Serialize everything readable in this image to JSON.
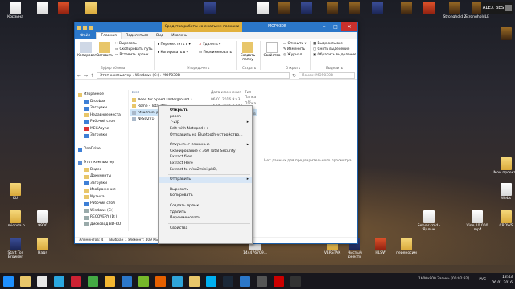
{
  "desktop": {
    "user_name": "ALEX BES",
    "icons": [
      {
        "label": "Корзина",
        "type": "file"
      },
      {
        "label": "",
        "type": "file"
      },
      {
        "label": "",
        "type": "red"
      },
      {
        "label": "",
        "type": "folder"
      },
      {
        "label": "",
        "type": "app"
      },
      {
        "label": "",
        "type": "file"
      },
      {
        "label": "",
        "type": "game"
      },
      {
        "label": "",
        "type": "app"
      },
      {
        "label": "",
        "type": "game"
      },
      {
        "label": "",
        "type": "game"
      },
      {
        "label": "",
        "type": "app"
      },
      {
        "label": "",
        "type": "game"
      },
      {
        "label": "",
        "type": "red"
      },
      {
        "label": "Stronghold 2",
        "type": "game"
      },
      {
        "label": "StrongholdLE",
        "type": "game"
      },
      {
        "label": "",
        "type": "game"
      },
      {
        "label": "KU",
        "type": "folder"
      },
      {
        "label": "Lmionda.b",
        "type": "folder"
      },
      {
        "label": "9900",
        "type": "file"
      },
      {
        "label": "Start Tor Browser",
        "type": "app"
      },
      {
        "label": "Надя",
        "type": "folder"
      },
      {
        "label": "144476709...",
        "type": "file"
      },
      {
        "label": "VERSTAK",
        "type": "folder"
      },
      {
        "label": "Чистый реестр",
        "type": "app"
      },
      {
        "label": "HLSW",
        "type": "red"
      },
      {
        "label": "переносим",
        "type": "folder"
      },
      {
        "label": "Server.cmd - Ярлык",
        "type": "file"
      },
      {
        "label": "Vine 10.000 .mp4",
        "type": "file"
      },
      {
        "label": "CROWS",
        "type": "folder"
      },
      {
        "label": "Мои проекты",
        "type": "folder"
      },
      {
        "label": "Webs",
        "type": "file"
      }
    ]
  },
  "explorer": {
    "title": "МОР030В",
    "context_tab": "Средства работы со сжатыми папками",
    "tabs": [
      "Файл",
      "Главная",
      "Поделиться",
      "Вид",
      "Извлечь"
    ],
    "active_tab": "Главная",
    "ribbon": {
      "copy": "Копировать",
      "paste": "Вставить",
      "cut": "Вырезать",
      "copy_path": "Скопировать путь",
      "paste_shortcut": "Вставить ярлык",
      "group_clipboard": "Буфер обмена",
      "move_to": "Переместить в",
      "copy_to": "Копировать в",
      "delete": "Удалить",
      "rename": "Переименовать",
      "group_organize": "Упорядочить",
      "new_folder": "Создать папку",
      "group_create": "Создать",
      "properties": "Свойства",
      "group_open": "Открыть",
      "open": "Открыть",
      "edit": "Изменить",
      "history": "Журнал",
      "select_all": "Выделить все",
      "select_none": "Снять выделение",
      "invert": "Обратить выделение",
      "group_select": "Выделить"
    },
    "address": "Этот компьютер › Windows (C:) › МОР030В",
    "search_placeholder": "Поиск: МОР030В",
    "nav": [
      {
        "label": "Избранное",
        "sub": false,
        "color": "#e8c66a"
      },
      {
        "label": "Dropbox",
        "sub": true,
        "color": "#3d7fd6"
      },
      {
        "label": "Загрузки",
        "sub": true,
        "color": "#3d7fd6"
      },
      {
        "label": "Недавние места",
        "sub": true,
        "color": "#e8c66a"
      },
      {
        "label": "Рабочий стол",
        "sub": true,
        "color": "#3d7fd6"
      },
      {
        "label": "MEGAsync",
        "sub": true,
        "color": "#d33"
      },
      {
        "label": "Загрузки",
        "sub": true,
        "color": "#3d7fd6"
      },
      {
        "label": "",
        "sub": false,
        "color": "#fff"
      },
      {
        "label": "OneDrive",
        "sub": false,
        "color": "#3d7fd6"
      },
      {
        "label": "",
        "sub": false,
        "color": "#fff"
      },
      {
        "label": "Этот компьютер",
        "sub": false,
        "color": "#5a8dd6"
      },
      {
        "label": "Видео",
        "sub": true,
        "color": "#e8c66a"
      },
      {
        "label": "Документы",
        "sub": true,
        "color": "#e8c66a"
      },
      {
        "label": "Загрузки",
        "sub": true,
        "color": "#3d7fd6"
      },
      {
        "label": "Изображения",
        "sub": true,
        "color": "#e8c66a"
      },
      {
        "label": "Музыка",
        "sub": true,
        "color": "#e8c66a"
      },
      {
        "label": "Рабочий стол",
        "sub": true,
        "color": "#3d7fd6"
      },
      {
        "label": "Windows (C:)",
        "sub": true,
        "color": "#9aa"
      },
      {
        "label": "RECOVERY (D:)",
        "sub": true,
        "color": "#9aa"
      },
      {
        "label": "Дисковод BD-RO",
        "sub": true,
        "color": "#9aa"
      }
    ],
    "columns": [
      "Имя",
      "Дата изменения",
      "Тип"
    ],
    "files": [
      {
        "name": "Need for Speed Underground 2",
        "date": "06.01.2016 9:43",
        "type": "Папка с ф",
        "selected": false,
        "color": "#e8c66a"
      },
      {
        "name": "Rome - Total War",
        "date": "16.06.2015 22:44",
        "type": "Папка с ф",
        "selected": false,
        "color": "#e8c66a"
      },
      {
        "name": "nfsu2mini-pk8.zip",
        "date": "06.01.2016 13:38",
        "type": "zip-Архив",
        "selected": true,
        "color": "#a9b8c9"
      },
      {
        "name": "NFSU2V1-",
        "date": "",
        "type": "",
        "selected": false,
        "color": "#a9b8c9"
      }
    ],
    "preview_text": "Нет данных для предварительного просмотра.",
    "status": {
      "items": "Элементов: 4",
      "selected": "Выбран 1 элемент: 409 КБ"
    }
  },
  "context_menu": [
    {
      "label": "Открыть",
      "bold": true,
      "arrow": false,
      "sep_before": false,
      "hl": false
    },
    {
      "label": "poosh",
      "bold": false,
      "arrow": false,
      "sep_before": false,
      "hl": false
    },
    {
      "label": "7-Zip",
      "bold": false,
      "arrow": true,
      "sep_before": false,
      "hl": false
    },
    {
      "label": "Edit with Notepad++",
      "bold": false,
      "arrow": false,
      "sep_before": false,
      "hl": false
    },
    {
      "label": "Отправить на Bluetooth-устройство...",
      "bold": false,
      "arrow": false,
      "sep_before": false,
      "hl": false
    },
    {
      "label": "Открыть с помощью",
      "bold": false,
      "arrow": true,
      "sep_before": true,
      "hl": false
    },
    {
      "label": "Сканирование с 360 Total Security",
      "bold": false,
      "arrow": false,
      "sep_before": false,
      "hl": false
    },
    {
      "label": "Extract files...",
      "bold": false,
      "arrow": false,
      "sep_before": false,
      "hl": false
    },
    {
      "label": "Extract Here",
      "bold": false,
      "arrow": false,
      "sep_before": false,
      "hl": false
    },
    {
      "label": "Extract to nfsu2mini-pk8\\",
      "bold": false,
      "arrow": false,
      "sep_before": false,
      "hl": false
    },
    {
      "label": "Отправить",
      "bold": false,
      "arrow": true,
      "sep_before": true,
      "hl": true
    },
    {
      "label": "Вырезать",
      "bold": false,
      "arrow": false,
      "sep_before": true,
      "hl": false
    },
    {
      "label": "Копировать",
      "bold": false,
      "arrow": false,
      "sep_before": false,
      "hl": false
    },
    {
      "label": "Создать ярлык",
      "bold": false,
      "arrow": false,
      "sep_before": true,
      "hl": false
    },
    {
      "label": "Удалить",
      "bold": false,
      "arrow": false,
      "sep_before": false,
      "hl": false
    },
    {
      "label": "Переименовать",
      "bold": false,
      "arrow": false,
      "sep_before": false,
      "hl": false
    },
    {
      "label": "Свойства",
      "bold": false,
      "arrow": false,
      "sep_before": true,
      "hl": false
    }
  ],
  "taskbar": {
    "apps": [
      "windows-logo",
      "explorer",
      "media",
      "skype",
      "game",
      "edit",
      "chrome",
      "store",
      "utorrent",
      "firefox",
      "photoshop",
      "explorer-open",
      "skype2",
      "steam",
      "mail",
      "game2",
      "opera",
      "app3"
    ],
    "colors": [
      "#1e90ff",
      "#e8c66a",
      "#e7e7e7",
      "#2aa7e0",
      "#c23",
      "#4a4",
      "#f2b632",
      "#2b77c9",
      "#76b82a",
      "#e66000",
      "#2fa4d9",
      "#e8c66a",
      "#00aff0",
      "#1b2838",
      "#2b77c9",
      "#555",
      "#c00",
      "#333"
    ],
    "resolution": "1600x900",
    "session": "Запись [00:02:32]",
    "lang": "РУС",
    "time": "13:43",
    "date": "06.01.2016"
  }
}
